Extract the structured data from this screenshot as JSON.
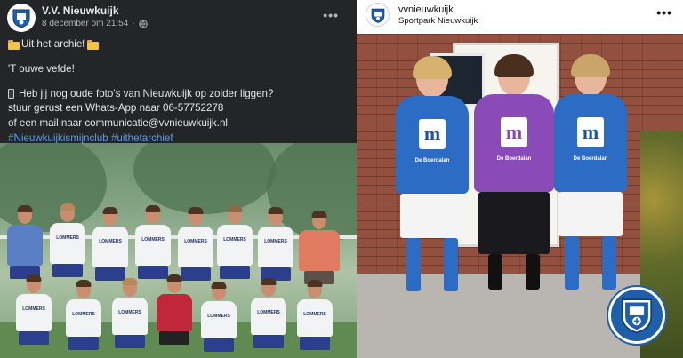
{
  "facebook_post": {
    "page_name": "V.V. Nieuwkuijk",
    "timestamp": "8 december om 21:54",
    "more_icon": "more-horizontal-icon",
    "audience_icon": "globe-icon",
    "text": {
      "archive_line": "Uit het archief",
      "subtitle": "'T ouwe vefde!",
      "question": "Heb jij nog oude foto's van Nieuwkuijk op zolder liggen?",
      "whatsapp": "stuur gerust een Whats-App naar 06-57752278",
      "email": "of een mail naar communicatie@vvnieuwkuijk.nl",
      "hashtags": "#Nieuwkuijkismijnclub #uithetarchief"
    },
    "photo_sponsor": "LOMMERS"
  },
  "instagram_post": {
    "username": "vvnieuwkuijk",
    "location": "Sportpark Nieuwkuijk",
    "more_icon": "more-horizontal-icon",
    "shirt_logo": "m",
    "shirt_sponsor": "De Boerdalan"
  },
  "colors": {
    "fb_background": "#242526",
    "fb_text": "#e4e6eb",
    "fb_hashtag": "#5a9bee",
    "club_blue": "#1f5ea8",
    "keeper_purple": "#8a4bb8"
  }
}
